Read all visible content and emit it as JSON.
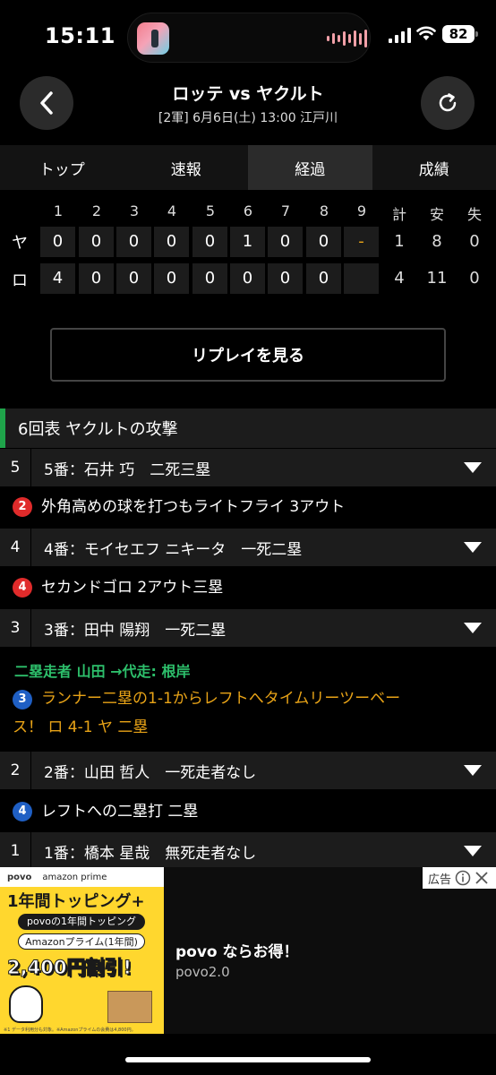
{
  "status": {
    "time": "15:11",
    "battery": "82"
  },
  "header": {
    "title": "ロッテ vs ヤクルト",
    "subtitle": "[2軍] 6月6日(土) 13:00 江戸川"
  },
  "tabs": [
    {
      "label": "トップ"
    },
    {
      "label": "速報"
    },
    {
      "label": "経過",
      "active": true
    },
    {
      "label": "成績"
    }
  ],
  "scoreboard": {
    "innings": [
      "1",
      "2",
      "3",
      "4",
      "5",
      "6",
      "7",
      "8",
      "9"
    ],
    "totals_headers": [
      "計",
      "安",
      "失"
    ],
    "teams": [
      {
        "label": "ヤ",
        "scores": [
          "0",
          "0",
          "0",
          "0",
          "0",
          "1",
          "0",
          "0",
          "-"
        ],
        "totals": [
          "1",
          "8",
          "0"
        ]
      },
      {
        "label": "ロ",
        "scores": [
          "4",
          "0",
          "0",
          "0",
          "0",
          "0",
          "0",
          "0",
          ""
        ],
        "totals": [
          "4",
          "11",
          "0"
        ]
      }
    ]
  },
  "replay_label": "リプレイを見る",
  "inning_header": "6回表 ヤクルトの攻撃",
  "plays": {
    "b5": {
      "num": "5",
      "text": "5番：石井 巧　二死三塁"
    },
    "p5": {
      "badge": "2",
      "text": "外角高めの球を打つもライトフライ 3アウト"
    },
    "b4": {
      "num": "4",
      "text": "4番：モイセエフ ニキータ　一死二塁"
    },
    "p4": {
      "badge": "4",
      "text": "セカンドゴロ 2アウト三塁"
    },
    "b3": {
      "num": "3",
      "text": "3番：田中 陽翔　一死二塁"
    },
    "sub": "二塁走者 山田 →代走: 根岸",
    "p3": {
      "badge": "3",
      "line1": "ランナー二塁の1-1からレフトへタイムリーツーベー",
      "line2": "ス！ ロ 4-1 ヤ 二塁"
    },
    "b2": {
      "num": "2",
      "text": "2番：山田 哲人　一死走者なし"
    },
    "p2": {
      "badge": "4",
      "text": "レフトへの二塁打 二塁"
    },
    "b1": {
      "num": "1",
      "text": "1番：橋本 星哉　無死走者なし"
    }
  },
  "ad": {
    "brand_povo": "povo",
    "brand_prime": "amazon prime",
    "headline": "1年間トッピング+",
    "pill1": "povoの1年間トッピング",
    "pill2": "Amazonプライム(1年間)",
    "price": "2,400円割引!",
    "fine": "※1 データ利用分も対象。※Amazonプライムの会費は4,800円。",
    "badge": "広告",
    "title": "povo ならお得！",
    "subtitle": "povo2.0"
  },
  "colors": {
    "accent_green": "#1fa34a",
    "badge_red": "#e02b2b",
    "badge_blue": "#1f5fc4",
    "highlight_text": "#e8a317"
  }
}
